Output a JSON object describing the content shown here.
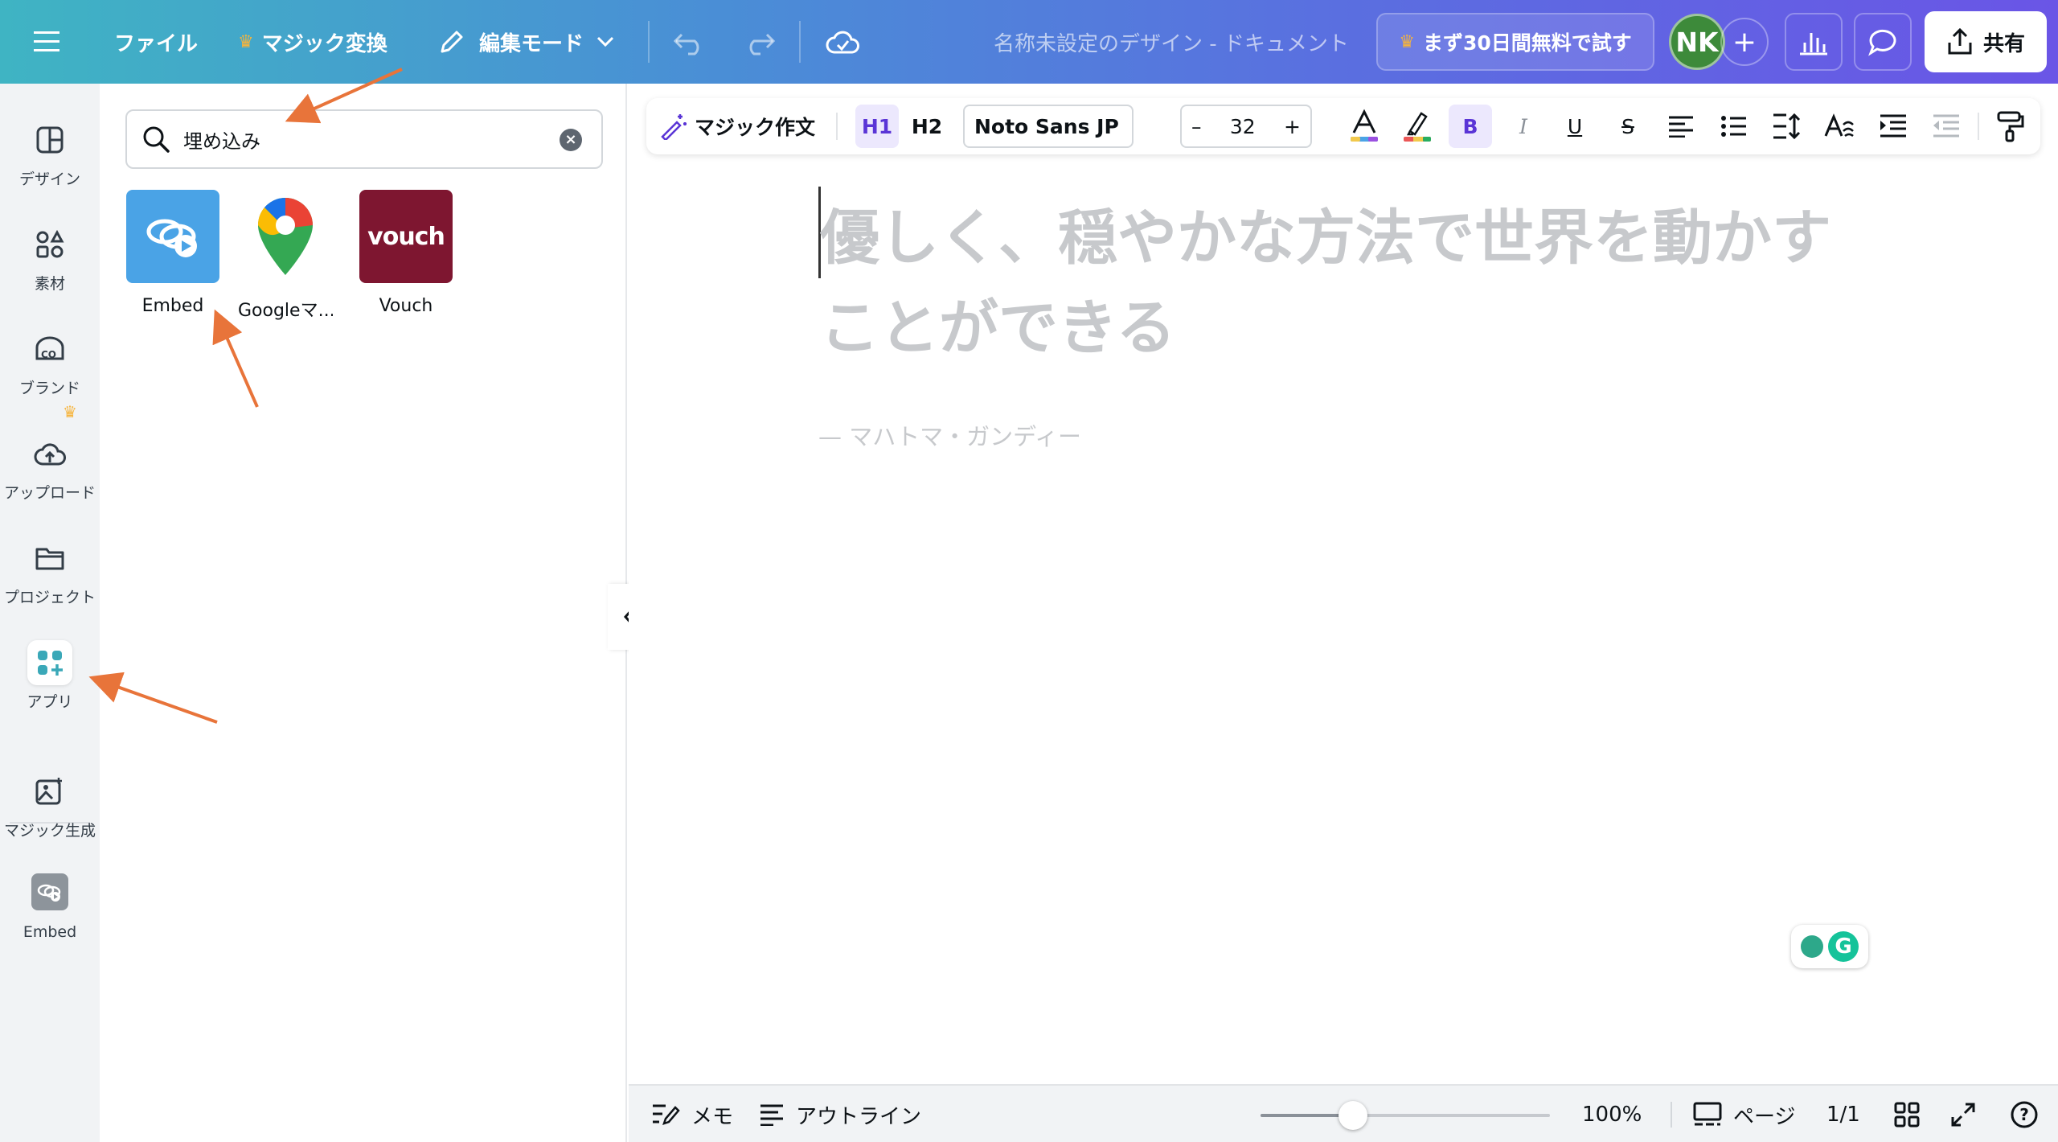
{
  "topbar": {
    "file_label": "ファイル",
    "magic_switch_label": "マジック変換",
    "edit_mode_label": "編集モード",
    "doc_title": "名称未設定のデザイン - ドキュメント",
    "trial_label": "まず30日間無料で試す",
    "avatar_initials": "NK",
    "share_label": "共有"
  },
  "rail": {
    "items": [
      {
        "label": "デザイン",
        "icon": "design-icon"
      },
      {
        "label": "素材",
        "icon": "elements-icon"
      },
      {
        "label": "ブランド",
        "icon": "brand-icon"
      },
      {
        "label": "アップロード",
        "icon": "upload-icon"
      },
      {
        "label": "プロジェクト",
        "icon": "folder-icon"
      },
      {
        "label": "アプリ",
        "icon": "apps-icon"
      },
      {
        "label": "マジック生成",
        "icon": "magic-media-icon"
      },
      {
        "label": "Embed",
        "icon": "embed-icon"
      }
    ]
  },
  "panel": {
    "search_value": "埋め込み",
    "apps": [
      {
        "name": "Embed",
        "icon": "embed-app-icon"
      },
      {
        "name": "Googleマ...",
        "icon": "google-maps-icon"
      },
      {
        "name": "Vouch",
        "icon": "vouch-icon",
        "logo_text": "vouch"
      }
    ]
  },
  "format_toolbar": {
    "magic_write_label": "マジック作文",
    "h1_label": "H1",
    "h2_label": "H2",
    "font_name": "Noto Sans JP",
    "font_size": "32",
    "minus": "–",
    "plus": "+",
    "bold_label": "B",
    "italic_label": "I",
    "underline_label": "U",
    "strike_label": "S"
  },
  "canvas": {
    "quote": "優しく、穏やかな方法で世界を動かすことができる",
    "author": "— マハトマ・ガンディー"
  },
  "bottom": {
    "notes_label": "メモ",
    "outline_label": "アウトライン",
    "zoom": "100%",
    "zoom_fraction": 0.32,
    "pages_label": "ページ",
    "page_count": "1/1",
    "help_label": "?"
  },
  "colors": {
    "accent": "#5a35d6",
    "annotation_arrow": "#e8743a",
    "embed_tile": "#4aa3e6",
    "vouch_tile": "#7e1630"
  }
}
